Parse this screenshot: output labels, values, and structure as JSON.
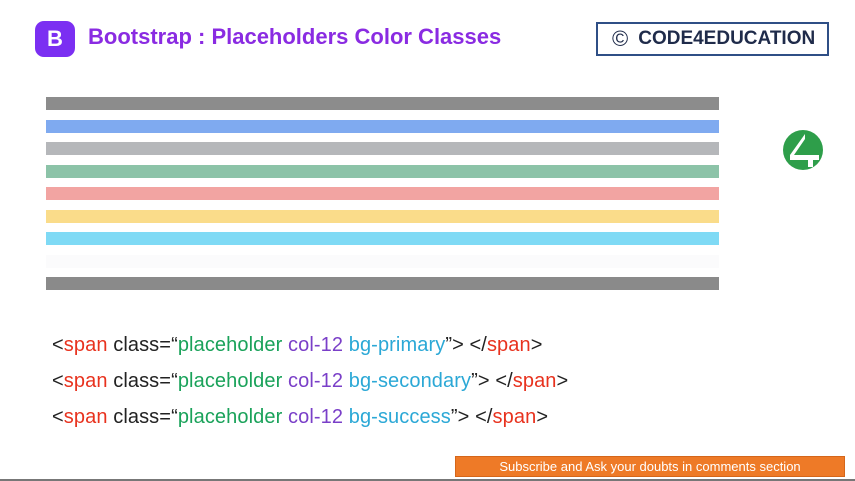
{
  "header": {
    "logo_letter": "B",
    "title": "Bootstrap : Placeholders Color Classes",
    "brand": "CODE4EDUCATION",
    "copyright_symbol": "©"
  },
  "placeholders": [
    {
      "name": "placeholder-bar-default",
      "color": "#8c8c8c"
    },
    {
      "name": "placeholder-bar-primary",
      "color": "#7faaf0"
    },
    {
      "name": "placeholder-bar-secondary",
      "color": "#b5b7ba"
    },
    {
      "name": "placeholder-bar-success",
      "color": "#8cc3a8"
    },
    {
      "name": "placeholder-bar-danger",
      "color": "#f2a4a2"
    },
    {
      "name": "placeholder-bar-warning",
      "color": "#fadc8a"
    },
    {
      "name": "placeholder-bar-info",
      "color": "#7fdaf5"
    },
    {
      "name": "placeholder-bar-light",
      "color": "#fbfbfc"
    },
    {
      "name": "placeholder-bar-dark",
      "color": "#8a8a8a"
    }
  ],
  "code_lines": [
    {
      "open": "<",
      "tag": "span",
      "attr": " class=“",
      "val": "placeholder ",
      "col": "col-12 ",
      "bg": "bg-primary",
      "close_attr": "”> </",
      "end_tag": "span",
      "end": ">"
    },
    {
      "open": "<",
      "tag": "span",
      "attr": " class=“",
      "val": "placeholder ",
      "col": "col-12 ",
      "bg": "bg-secondary",
      "close_attr": "”> </",
      "end_tag": "span",
      "end": ">"
    },
    {
      "open": "<",
      "tag": "span",
      "attr": " class=“",
      "val": "placeholder ",
      "col": "col-12 ",
      "bg": "bg-success",
      "close_attr": "”> </",
      "end_tag": "span",
      "end": ">"
    }
  ],
  "footer": {
    "subscribe_text": "Subscribe and Ask your doubts in comments section"
  }
}
